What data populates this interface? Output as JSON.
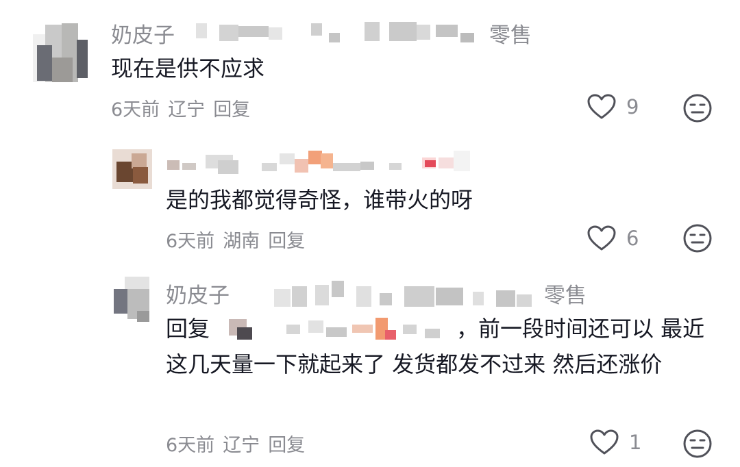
{
  "comments": [
    {
      "author_prefix": "奶皮子",
      "author_suffix": "零售",
      "text": "现在是供不应求",
      "time": "6天前",
      "location": "辽宁",
      "reply_label": "回复",
      "likes": "9"
    },
    {
      "author_prefix": "",
      "author_suffix": "",
      "text": "是的我都觉得奇怪，谁带火的呀",
      "time": "6天前",
      "location": "湖南",
      "reply_label": "回复",
      "likes": "6"
    },
    {
      "author_prefix": "奶皮子",
      "author_suffix": "零售",
      "reply_prefix": "回复",
      "text": "，前一段时间还可以 最近这几天量一下就起来了 发货都发不过来 然后还涨价",
      "time": "6天前",
      "location": "辽宁",
      "reply_label": "回复",
      "likes": "1"
    }
  ],
  "colors": {
    "primary_text": "#161823",
    "secondary_text": "#8a8b91",
    "icon_stroke": "#505159"
  },
  "icons": {
    "like": "heart-outline-icon",
    "dislike": "neutral-face-icon"
  }
}
